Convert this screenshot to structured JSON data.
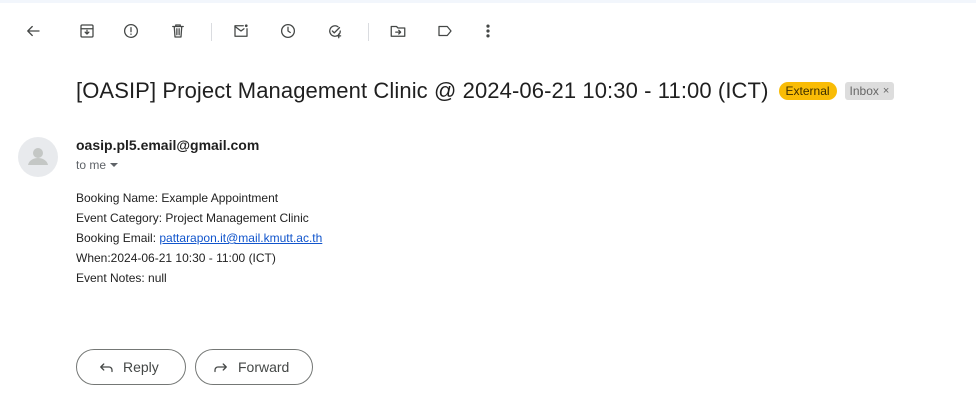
{
  "toolbar": {
    "icons": [
      "back-arrow-icon",
      "archive-icon",
      "report-spam-icon",
      "delete-icon",
      "mark-unread-icon",
      "snooze-icon",
      "add-to-tasks-icon",
      "move-to-icon",
      "label-icon",
      "more-options-icon"
    ]
  },
  "message": {
    "subject": "[OASIP] Project Management Clinic @ 2024-06-21 10:30 - 11:00 (ICT)",
    "labels": {
      "external": "External",
      "inbox": "Inbox",
      "inbox_remove": "×"
    },
    "sender": "oasip.pl5.email@gmail.com",
    "recipient": "to me",
    "body": {
      "booking_name": "Booking Name: Example Appointment",
      "event_category": "Event Category: Project Management Clinic",
      "booking_email_label": "Booking Email: ",
      "booking_email": "pattarapon.it@mail.kmutt.ac.th",
      "when": "When:2024-06-21 10:30 - 11:00 (ICT)",
      "notes": "Event Notes: null"
    }
  },
  "actions": {
    "reply": "Reply",
    "forward": "Forward"
  },
  "colors": {
    "external_label": "#f9bc06",
    "inbox_label": "#dddddd",
    "link": "#1155cc"
  }
}
